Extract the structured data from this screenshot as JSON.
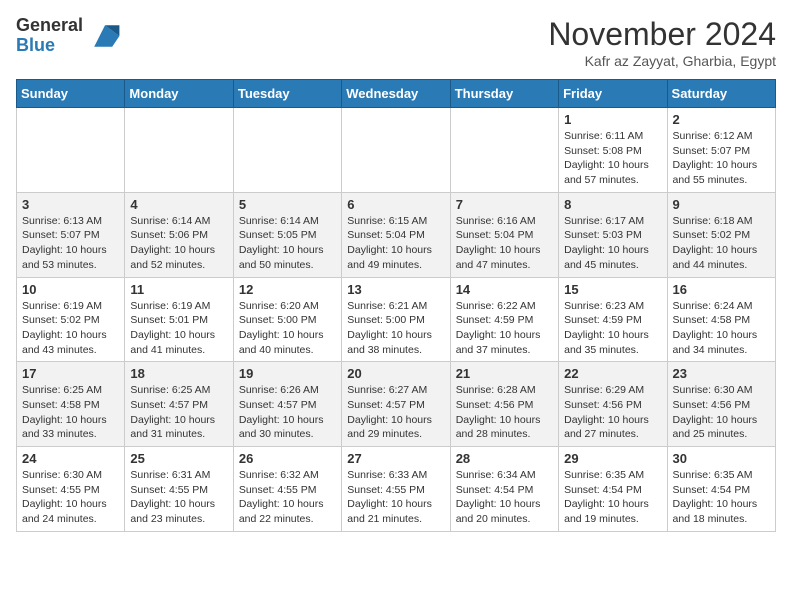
{
  "header": {
    "logo_general": "General",
    "logo_blue": "Blue",
    "month_title": "November 2024",
    "location": "Kafr az Zayyat, Gharbia, Egypt"
  },
  "weekdays": [
    "Sunday",
    "Monday",
    "Tuesday",
    "Wednesday",
    "Thursday",
    "Friday",
    "Saturday"
  ],
  "weeks": [
    [
      {
        "day": "",
        "info": ""
      },
      {
        "day": "",
        "info": ""
      },
      {
        "day": "",
        "info": ""
      },
      {
        "day": "",
        "info": ""
      },
      {
        "day": "",
        "info": ""
      },
      {
        "day": "1",
        "info": "Sunrise: 6:11 AM\nSunset: 5:08 PM\nDaylight: 10 hours and 57 minutes."
      },
      {
        "day": "2",
        "info": "Sunrise: 6:12 AM\nSunset: 5:07 PM\nDaylight: 10 hours and 55 minutes."
      }
    ],
    [
      {
        "day": "3",
        "info": "Sunrise: 6:13 AM\nSunset: 5:07 PM\nDaylight: 10 hours and 53 minutes."
      },
      {
        "day": "4",
        "info": "Sunrise: 6:14 AM\nSunset: 5:06 PM\nDaylight: 10 hours and 52 minutes."
      },
      {
        "day": "5",
        "info": "Sunrise: 6:14 AM\nSunset: 5:05 PM\nDaylight: 10 hours and 50 minutes."
      },
      {
        "day": "6",
        "info": "Sunrise: 6:15 AM\nSunset: 5:04 PM\nDaylight: 10 hours and 49 minutes."
      },
      {
        "day": "7",
        "info": "Sunrise: 6:16 AM\nSunset: 5:04 PM\nDaylight: 10 hours and 47 minutes."
      },
      {
        "day": "8",
        "info": "Sunrise: 6:17 AM\nSunset: 5:03 PM\nDaylight: 10 hours and 45 minutes."
      },
      {
        "day": "9",
        "info": "Sunrise: 6:18 AM\nSunset: 5:02 PM\nDaylight: 10 hours and 44 minutes."
      }
    ],
    [
      {
        "day": "10",
        "info": "Sunrise: 6:19 AM\nSunset: 5:02 PM\nDaylight: 10 hours and 43 minutes."
      },
      {
        "day": "11",
        "info": "Sunrise: 6:19 AM\nSunset: 5:01 PM\nDaylight: 10 hours and 41 minutes."
      },
      {
        "day": "12",
        "info": "Sunrise: 6:20 AM\nSunset: 5:00 PM\nDaylight: 10 hours and 40 minutes."
      },
      {
        "day": "13",
        "info": "Sunrise: 6:21 AM\nSunset: 5:00 PM\nDaylight: 10 hours and 38 minutes."
      },
      {
        "day": "14",
        "info": "Sunrise: 6:22 AM\nSunset: 4:59 PM\nDaylight: 10 hours and 37 minutes."
      },
      {
        "day": "15",
        "info": "Sunrise: 6:23 AM\nSunset: 4:59 PM\nDaylight: 10 hours and 35 minutes."
      },
      {
        "day": "16",
        "info": "Sunrise: 6:24 AM\nSunset: 4:58 PM\nDaylight: 10 hours and 34 minutes."
      }
    ],
    [
      {
        "day": "17",
        "info": "Sunrise: 6:25 AM\nSunset: 4:58 PM\nDaylight: 10 hours and 33 minutes."
      },
      {
        "day": "18",
        "info": "Sunrise: 6:25 AM\nSunset: 4:57 PM\nDaylight: 10 hours and 31 minutes."
      },
      {
        "day": "19",
        "info": "Sunrise: 6:26 AM\nSunset: 4:57 PM\nDaylight: 10 hours and 30 minutes."
      },
      {
        "day": "20",
        "info": "Sunrise: 6:27 AM\nSunset: 4:57 PM\nDaylight: 10 hours and 29 minutes."
      },
      {
        "day": "21",
        "info": "Sunrise: 6:28 AM\nSunset: 4:56 PM\nDaylight: 10 hours and 28 minutes."
      },
      {
        "day": "22",
        "info": "Sunrise: 6:29 AM\nSunset: 4:56 PM\nDaylight: 10 hours and 27 minutes."
      },
      {
        "day": "23",
        "info": "Sunrise: 6:30 AM\nSunset: 4:56 PM\nDaylight: 10 hours and 25 minutes."
      }
    ],
    [
      {
        "day": "24",
        "info": "Sunrise: 6:30 AM\nSunset: 4:55 PM\nDaylight: 10 hours and 24 minutes."
      },
      {
        "day": "25",
        "info": "Sunrise: 6:31 AM\nSunset: 4:55 PM\nDaylight: 10 hours and 23 minutes."
      },
      {
        "day": "26",
        "info": "Sunrise: 6:32 AM\nSunset: 4:55 PM\nDaylight: 10 hours and 22 minutes."
      },
      {
        "day": "27",
        "info": "Sunrise: 6:33 AM\nSunset: 4:55 PM\nDaylight: 10 hours and 21 minutes."
      },
      {
        "day": "28",
        "info": "Sunrise: 6:34 AM\nSunset: 4:54 PM\nDaylight: 10 hours and 20 minutes."
      },
      {
        "day": "29",
        "info": "Sunrise: 6:35 AM\nSunset: 4:54 PM\nDaylight: 10 hours and 19 minutes."
      },
      {
        "day": "30",
        "info": "Sunrise: 6:35 AM\nSunset: 4:54 PM\nDaylight: 10 hours and 18 minutes."
      }
    ]
  ]
}
